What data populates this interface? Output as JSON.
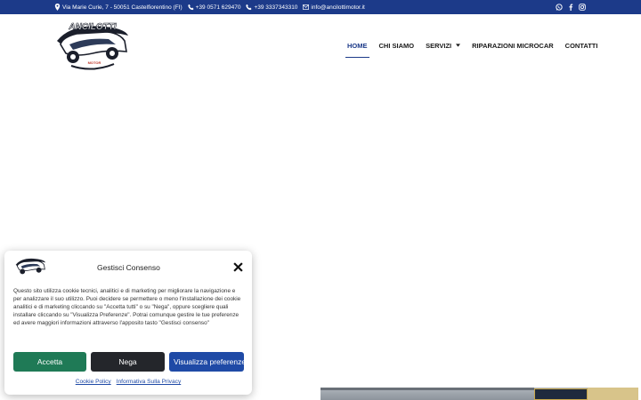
{
  "topbar": {
    "address": "Via Marie Curie, 7 - 50051 Castelfiorentino (FI)",
    "phone1": "+39 0571 629470",
    "phone2": "+39 3337343310",
    "email": "info@ancilottimotor.it",
    "social_icons": [
      "whatsapp-icon",
      "facebook-icon",
      "instagram-icon"
    ]
  },
  "header": {
    "logo_text": "ANCILOTTI",
    "logo_subtext": "MOTOR",
    "nav": [
      {
        "label": "HOME",
        "active": true
      },
      {
        "label": "CHI SIAMO"
      },
      {
        "label": "SERVIZI",
        "has_dropdown": true
      },
      {
        "label": "RIPARAZIONI MICROCAR"
      },
      {
        "label": "CONTATTI"
      }
    ]
  },
  "consent": {
    "title": "Gestisci Consenso",
    "text": "Questo sito utilizza cookie tecnici, analitici e di marketing per migliorare la navigazione e per analizzare il suo utilizzo. Puoi decidere se permettere o meno l'installazione dei cookie analitici e di marketing cliccando su \"Accetta tutti\" o su \"Nega\", oppure scegliere quali installare cliccando su \"Visualizza Preferenze\". Potrai comunque gestire le tue preferenze ed avere maggiori informazioni attraverso l'apposito tasto \"Gestisci consenso\"",
    "accept_label": "Accetta",
    "deny_label": "Nega",
    "preferences_label": "Visualizza preferenze",
    "cookie_policy_label": "Cookie Policy",
    "privacy_label": "Informativa Sulla Privacy"
  },
  "colors": {
    "brand_blue": "#1c3a89",
    "accept_green": "#1f7a56",
    "deny_dark": "#24262b",
    "preferences_blue": "#1f4aa6"
  }
}
